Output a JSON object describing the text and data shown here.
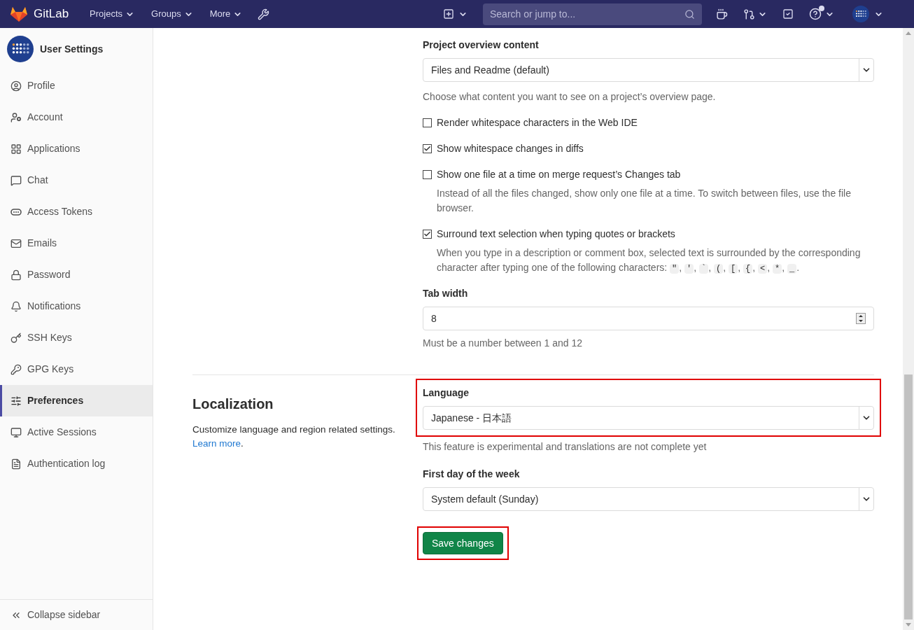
{
  "navbar": {
    "brand": "GitLab",
    "menus": [
      {
        "label": "Projects"
      },
      {
        "label": "Groups"
      },
      {
        "label": "More"
      }
    ],
    "search": {
      "placeholder": "Search or jump to..."
    }
  },
  "sidebar": {
    "title": "User Settings",
    "items": [
      {
        "label": "Profile",
        "selected": false
      },
      {
        "label": "Account",
        "selected": false
      },
      {
        "label": "Applications",
        "selected": false
      },
      {
        "label": "Chat",
        "selected": false
      },
      {
        "label": "Access Tokens",
        "selected": false
      },
      {
        "label": "Emails",
        "selected": false
      },
      {
        "label": "Password",
        "selected": false
      },
      {
        "label": "Notifications",
        "selected": false
      },
      {
        "label": "SSH Keys",
        "selected": false
      },
      {
        "label": "GPG Keys",
        "selected": false
      },
      {
        "label": "Preferences",
        "selected": true
      },
      {
        "label": "Active Sessions",
        "selected": false
      },
      {
        "label": "Authentication log",
        "selected": false
      }
    ],
    "collapse": "Collapse sidebar"
  },
  "behavior": {
    "project_overview": {
      "label": "Project overview content",
      "value": "Files and Readme (default)",
      "help": "Choose what content you want to see on a project’s overview page."
    },
    "checkboxes": [
      {
        "label": "Render whitespace characters in the Web IDE",
        "checked": false
      },
      {
        "label": "Show whitespace changes in diffs",
        "checked": true
      },
      {
        "label": "Show one file at a time on merge request’s Changes tab",
        "checked": false,
        "description": "Instead of all the files changed, show only one file at a time. To switch between files, use the file browser."
      },
      {
        "label": "Surround text selection when typing quotes or brackets",
        "checked": true,
        "description": "When you type in a description or comment box, selected text is surrounded by the corresponding character after typing one of the following characters:",
        "chars": [
          {
            "code": "\"",
            "after": ","
          },
          {
            "code": "'",
            "after": ","
          },
          {
            "code": "`",
            "after": ","
          },
          {
            "code": "(",
            "after": ","
          },
          {
            "code": "[",
            "after": ","
          },
          {
            "code": "{",
            "after": ","
          },
          {
            "code": "<",
            "after": ","
          },
          {
            "code": "*",
            "after": ","
          },
          {
            "code": "_",
            "after": "."
          }
        ]
      }
    ],
    "tab_width": {
      "label": "Tab width",
      "value": "8",
      "help": "Must be a number between 1 and 12"
    }
  },
  "localization": {
    "title": "Localization",
    "description": "Customize language and region related settings.",
    "link": "Learn more",
    "link_after": ".",
    "language": {
      "label": "Language",
      "value": "Japanese - 日本語",
      "help": "This feature is experimental and translations are not complete yet",
      "highlighted": true
    },
    "first_day": {
      "label": "First day of the week",
      "value": "System default (Sunday)"
    },
    "save": {
      "label": "Save changes",
      "highlighted": true
    }
  }
}
